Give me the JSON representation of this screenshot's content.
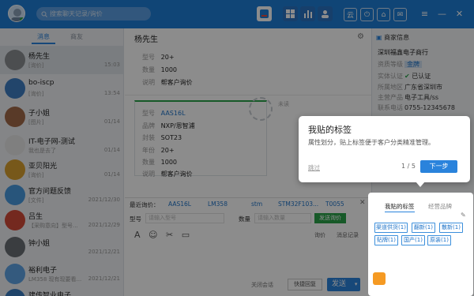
{
  "search": {
    "placeholder": "搜索聊天记录/询价"
  },
  "top_icons": [
    "spreadsheet-icon",
    "grid-apps-icon",
    "bar-chart-icon",
    "user-icon"
  ],
  "window_buttons": [
    "云",
    "⏻",
    "⌂",
    "✉"
  ],
  "left_tabs": [
    "消息",
    "商友"
  ],
  "conversations": [
    {
      "name": "杨先生",
      "preview": "[询价]",
      "time": "15:03"
    },
    {
      "name": "bo-iscp",
      "preview": "[询价]",
      "time": "13:54"
    },
    {
      "name": "子小姐",
      "preview": "[图片]",
      "time": "01/14"
    },
    {
      "name": "IT-电子网-测试",
      "preview": "我也是去了",
      "time": "01/14"
    },
    {
      "name": "亚贝阳光",
      "preview": "[询价]",
      "time": "01/14"
    },
    {
      "name": "官方问题反馈",
      "preview": "[文件]",
      "time": "2021/12/30"
    },
    {
      "name": "吕生",
      "preview": "【采购意向】型号...",
      "time": "2021/12/29"
    },
    {
      "name": "钟小姐",
      "preview": "",
      "time": "2021/12/21"
    },
    {
      "name": "裕利电子",
      "preview": "LM358 现有现要看...",
      "time": "2021/12/21"
    },
    {
      "name": "建传智业电子",
      "preview": "",
      "time": ""
    }
  ],
  "chat": {
    "title": "杨先生",
    "card1": [
      {
        "label": "型号",
        "value": "20+"
      },
      {
        "label": "数量",
        "value": "1000"
      },
      {
        "label": "说明",
        "value": "帮客户询价"
      }
    ],
    "card2": [
      {
        "label": "型号",
        "value": "AAS16L"
      },
      {
        "label": "品牌",
        "value": "NXP/恩智浦"
      },
      {
        "label": "封装",
        "value": "SOT23"
      },
      {
        "label": "年份",
        "value": "20+"
      },
      {
        "label": "数量",
        "value": "1000"
      },
      {
        "label": "说明",
        "value": "帮客户询价"
      }
    ],
    "unread": "未读"
  },
  "composer": {
    "recent_label": "最近询价：",
    "recent": [
      "AAS16L",
      "LM358",
      "stm",
      "STM32F103...",
      "T0055"
    ],
    "model_label": "型号",
    "model_placeholder": "请输入型号",
    "qty_label": "数量",
    "qty_placeholder": "请输入数量",
    "inquiry_button": "发送询价",
    "inquiry_link": "询价",
    "history_link": "消息记录",
    "close_label": "关闭会话",
    "quick_reply": "快捷回复",
    "send_label": "发送"
  },
  "merchant": {
    "title": "商家信息",
    "name": "深圳福鑫电子商行",
    "rows": [
      {
        "label": "资质等级",
        "value": "金牌"
      },
      {
        "label": "实体认证",
        "value": "已认证"
      },
      {
        "label": "所属地区",
        "value": "广东省深圳市"
      },
      {
        "label": "主营产品",
        "value": "电子工具/ss"
      },
      {
        "label": "联系电话",
        "value": "0755-12345678"
      }
    ]
  },
  "tip": {
    "title": "我贴的标签",
    "description": "属性划分，贴上标签便于客户分类精准管理。",
    "skip": "跳过",
    "page": "1 / 5",
    "next": "下一步"
  },
  "tags_panel": {
    "tab_mine": "我贴的标签",
    "tab_brand": "经营品牌",
    "tags": [
      "渠道供货(1)",
      "翻新(1)",
      "散新(1)",
      "贴牌(1)",
      "国产(1)",
      "原装(1)"
    ]
  },
  "colors": {
    "accent": "#2a83dc",
    "topbar": "#1e7fd8",
    "green": "#2ba34a"
  }
}
